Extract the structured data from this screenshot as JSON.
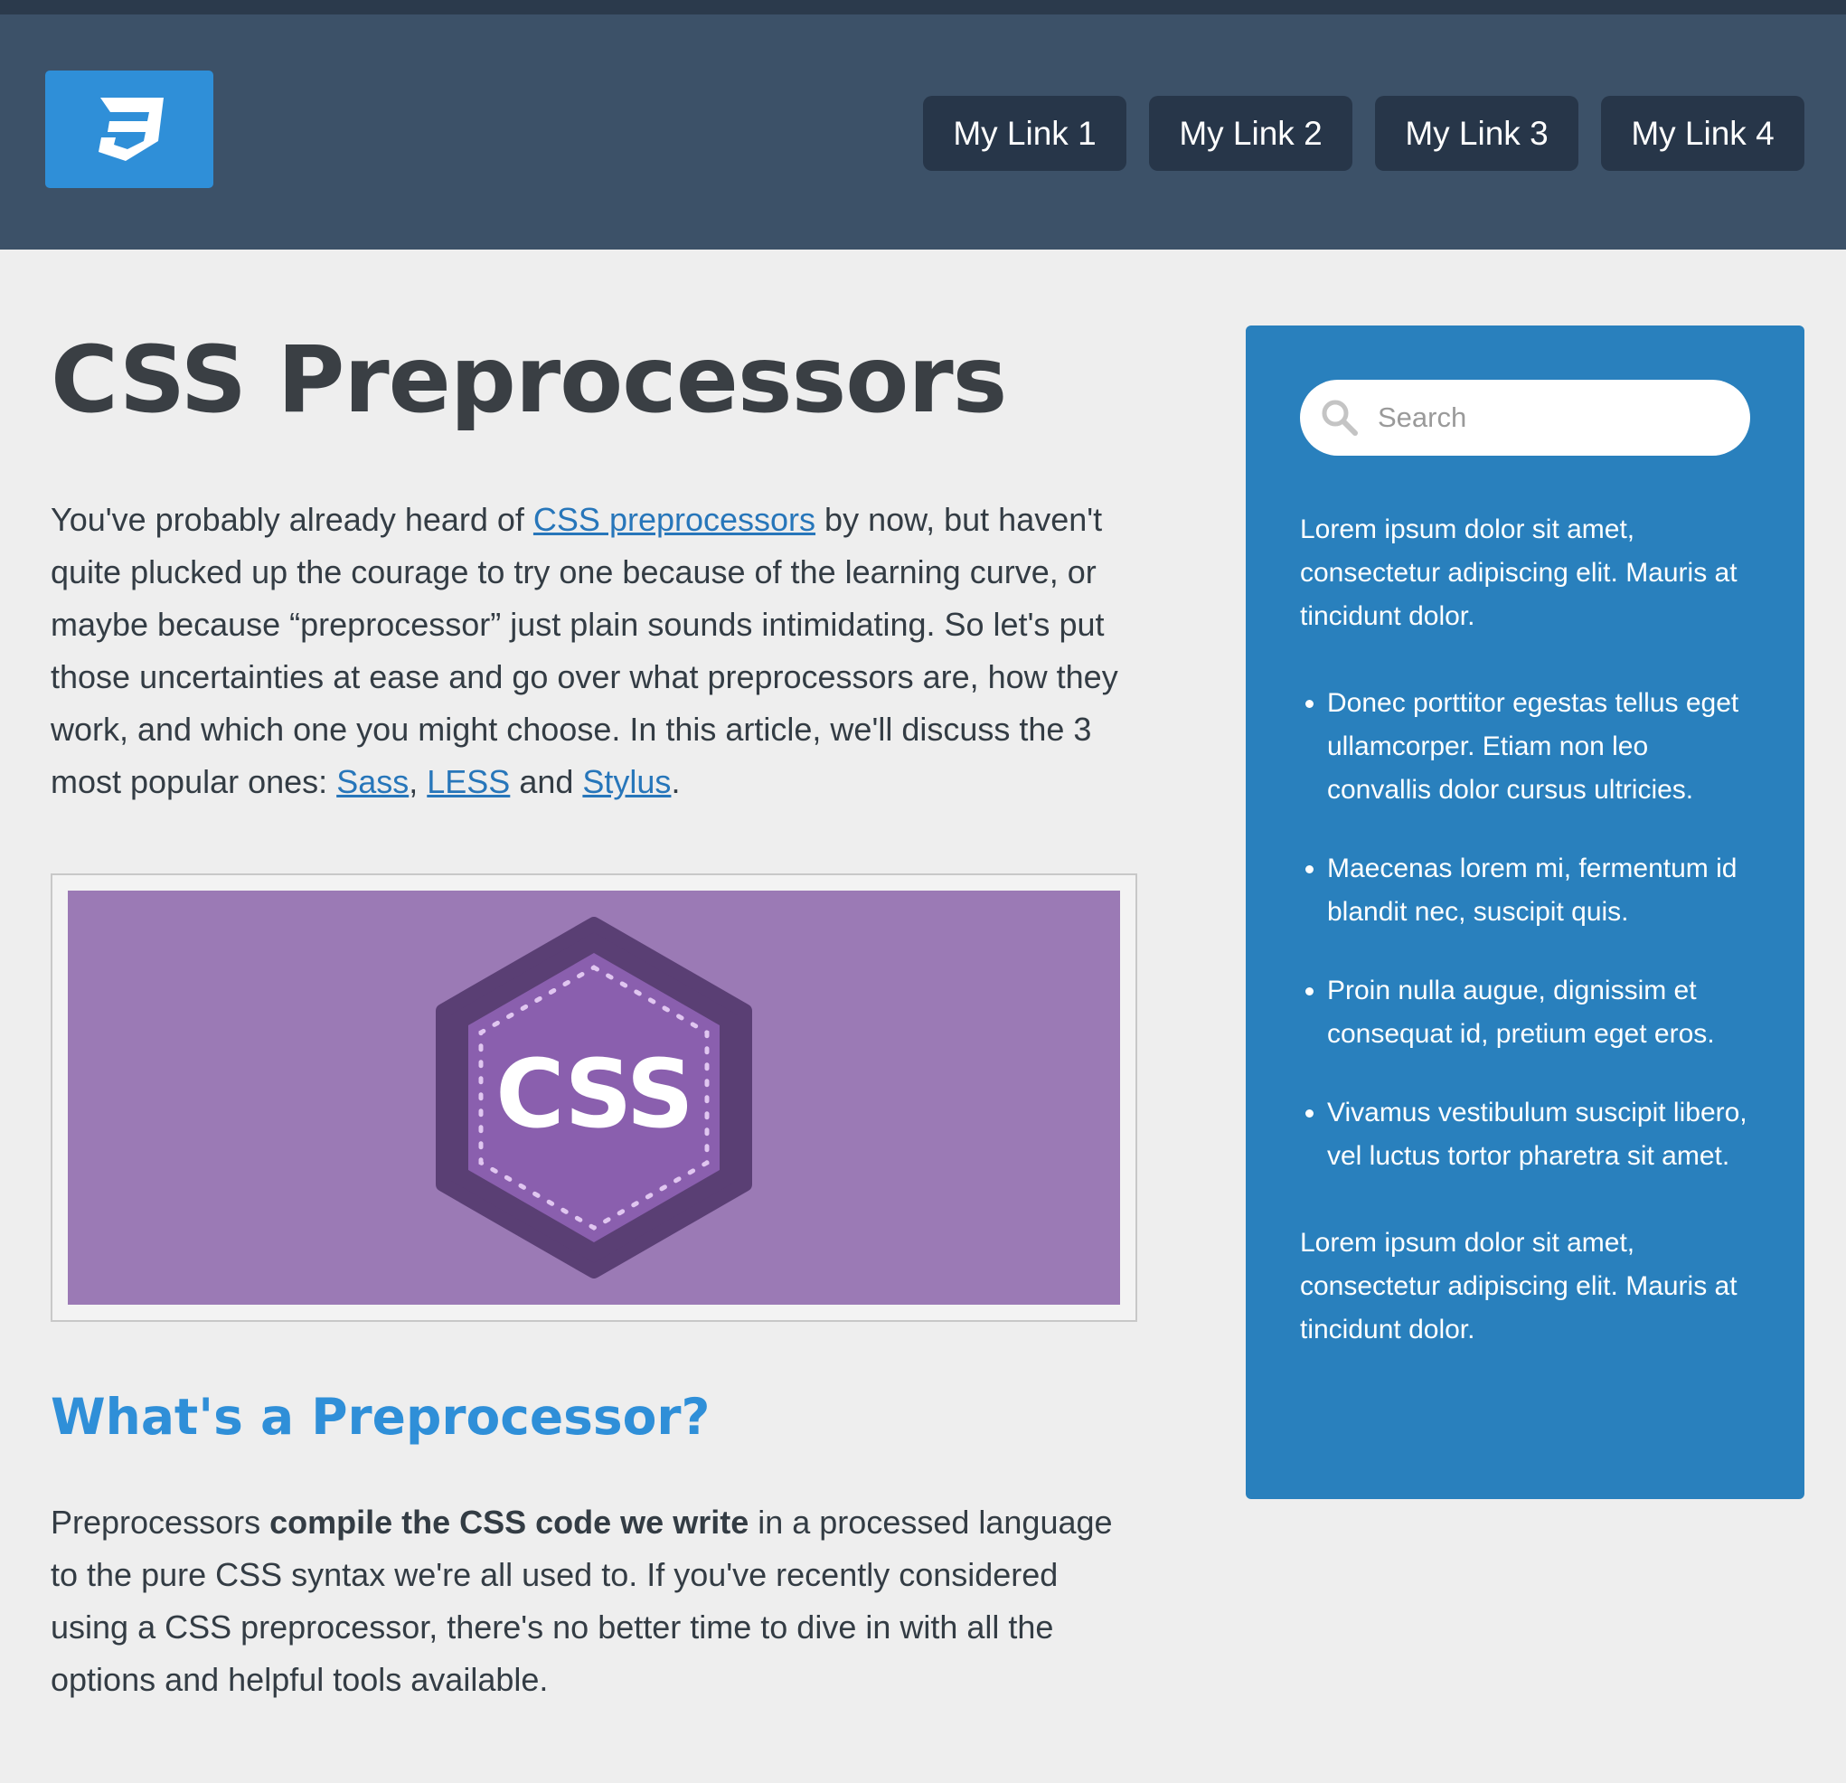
{
  "colors": {
    "header_bg": "#3c5168",
    "nav_bg": "#273649",
    "logo_bg": "#2f8fd8",
    "sidebar_bg": "#2980bd",
    "page_bg": "#eeeeee",
    "link": "#2776ba",
    "heading_accent": "#2f8fd8",
    "banner_bg": "#9b7ab5"
  },
  "header": {
    "logo_icon": "css3-logo-icon",
    "nav": [
      {
        "label": "My Link 1"
      },
      {
        "label": "My Link 2"
      },
      {
        "label": "My Link 3"
      },
      {
        "label": "My Link 4"
      }
    ]
  },
  "main": {
    "title": "CSS Preprocessors",
    "intro": {
      "t1": "You've probably already heard of ",
      "link1": "CSS preprocessors",
      "t2": " by now, but haven't quite plucked up the courage to try one because of the learning curve, or maybe because “preprocessor” just plain sounds intimidating. So let's put those uncertainties at ease and go over what preprocessors are, how they work, and which one you might choose. In this article, we'll discuss the 3 most popular ones: ",
      "link2": "Sass",
      "t3": ", ",
      "link3": "LESS",
      "t4": " and ",
      "link4": "Stylus",
      "t5": "."
    },
    "banner": {
      "badge_text": "CSS"
    },
    "section_heading": "What's a Preprocessor?",
    "para": {
      "t1": "Preprocessors ",
      "bold": "compile the CSS code we write",
      "t2": " in a processed language to the pure CSS syntax we're all used to. If you've recently considered using a CSS preprocessor, there's no better time to dive in with all the options and helpful tools available."
    }
  },
  "sidebar": {
    "search": {
      "placeholder": "Search",
      "icon": "search-icon"
    },
    "para1": "Lorem ipsum dolor sit amet, consectetur adipiscing elit. Mauris at tincidunt dolor.",
    "items": [
      "Donec porttitor egestas tellus eget ullamcorper. Etiam non leo convallis dolor cursus ultricies.",
      "Maecenas lorem mi, fermentum id blandit nec, suscipit quis.",
      "Proin nulla augue, dignissim et consequat id, pretium eget eros.",
      "Vivamus vestibulum suscipit libero, vel luctus tortor pharetra sit amet."
    ],
    "para2": "Lorem ipsum dolor sit amet, consectetur adipiscing elit. Mauris at tincidunt dolor."
  }
}
